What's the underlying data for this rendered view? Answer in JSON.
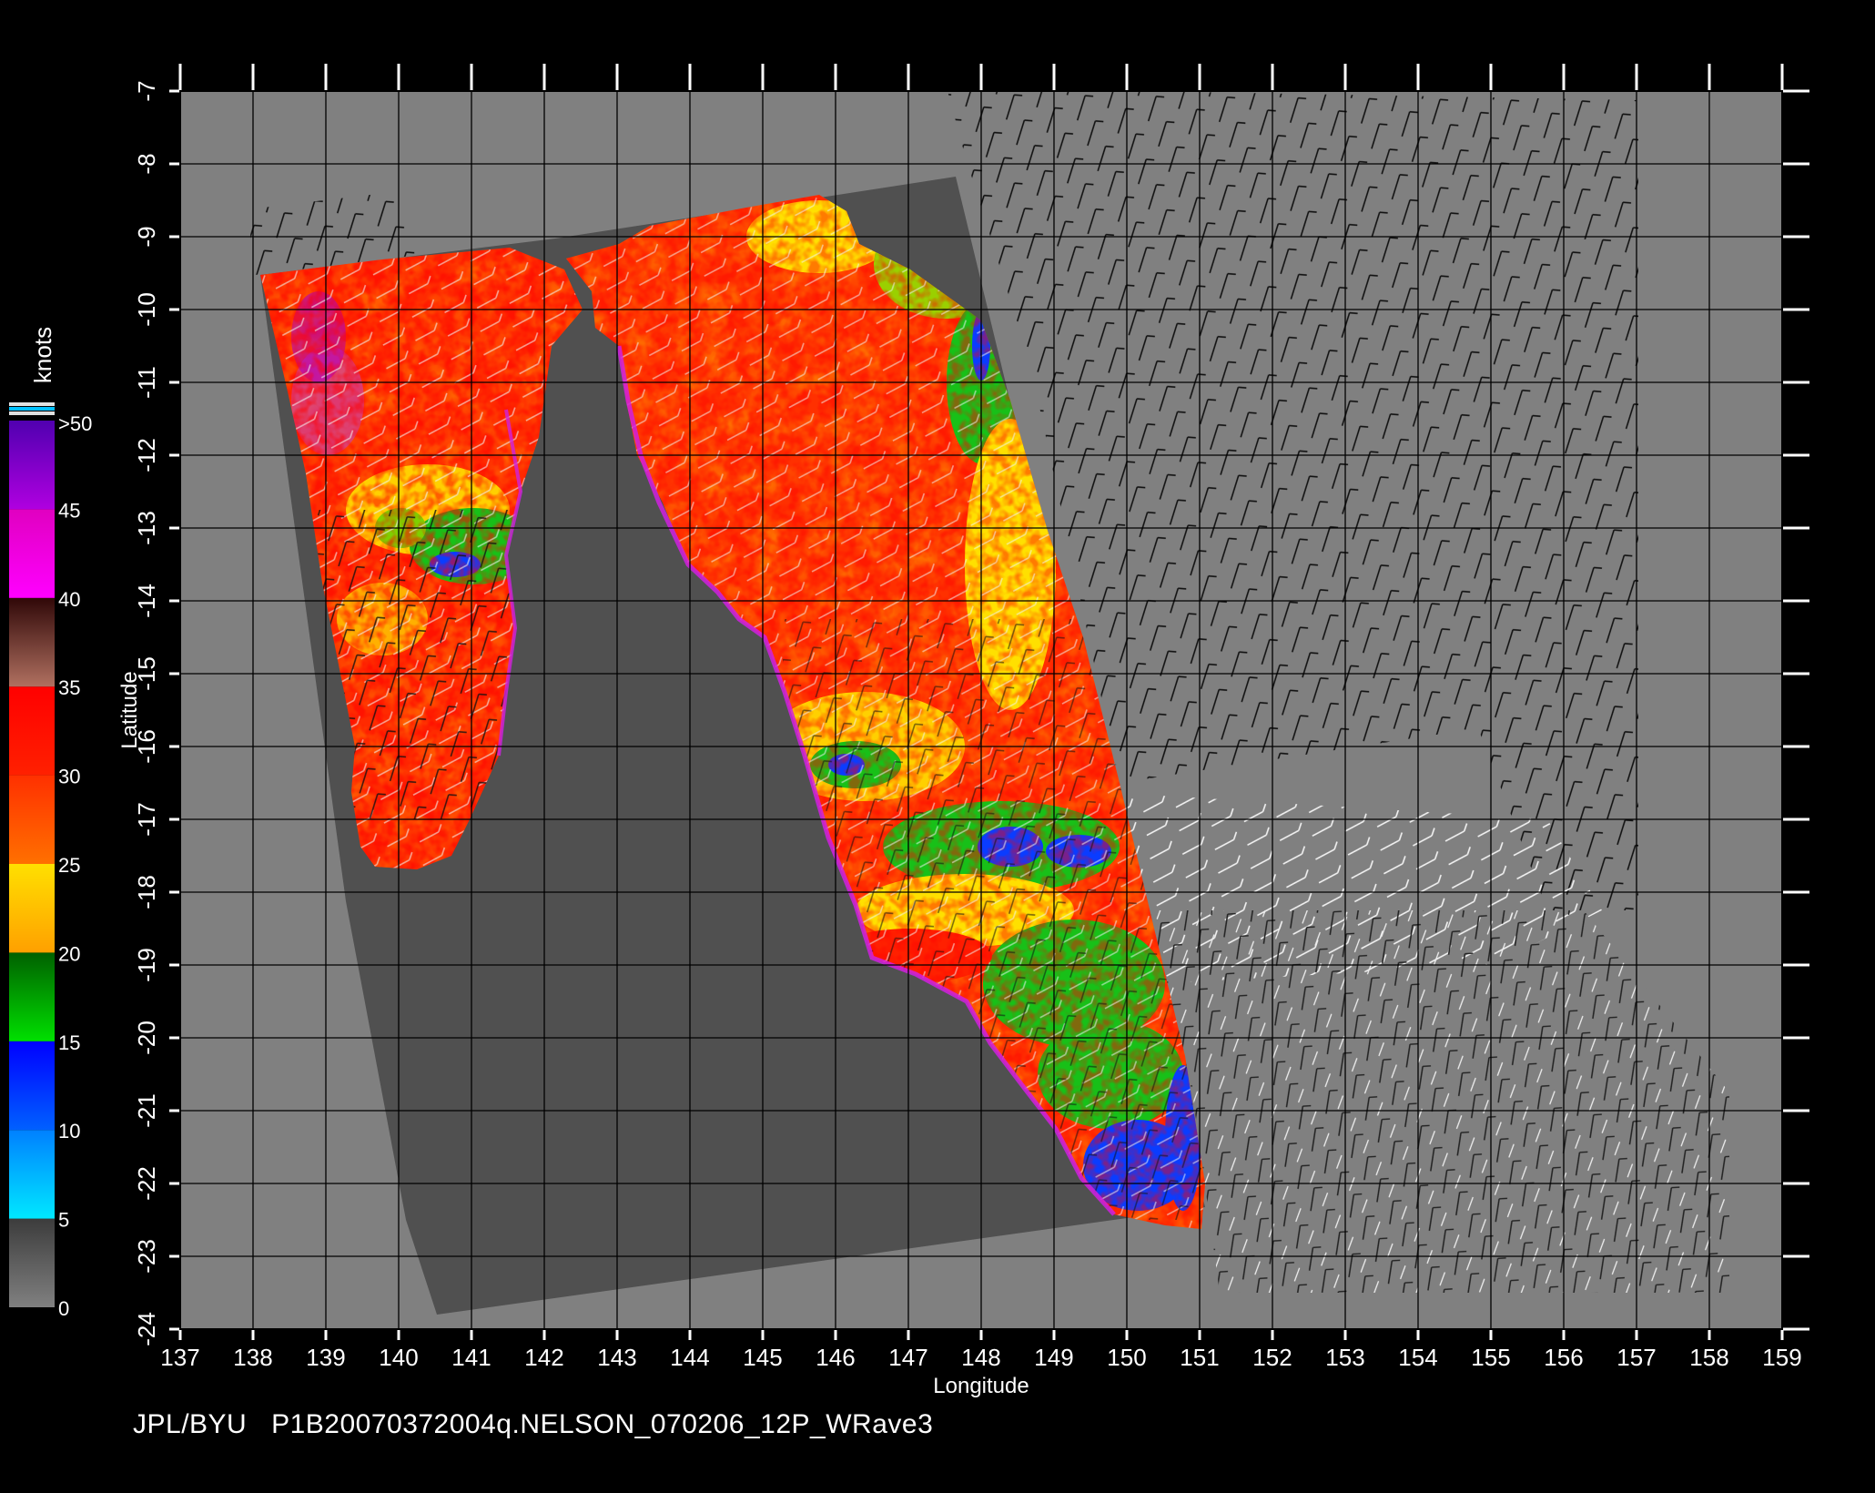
{
  "title_left": "JPL/BYU",
  "title_right": "P1B20070372004q.NELSON_070206_12P_WRave3",
  "axes": {
    "xlabel": "Longitude",
    "ylabel": "Latitude",
    "xlim": [
      137,
      159
    ],
    "ylim": [
      -24,
      -7
    ],
    "xticks": [
      "137",
      "138",
      "139",
      "140",
      "141",
      "142",
      "143",
      "144",
      "145",
      "146",
      "147",
      "148",
      "149",
      "150",
      "151",
      "152",
      "153",
      "154",
      "155",
      "156",
      "157",
      "158",
      "159"
    ],
    "yticks": [
      "-7",
      "-8",
      "-9",
      "-10",
      "-11",
      "-12",
      "-13",
      "-14",
      "-15",
      "-16",
      "-17",
      "-18",
      "-19",
      "-20",
      "-21",
      "-22",
      "-23",
      "-24"
    ]
  },
  "colorbar": {
    "unit": "knots",
    "labels": [
      ">50",
      "45",
      "40",
      "35",
      "30",
      "25",
      "20",
      "15",
      "10",
      "5",
      "0"
    ],
    "bins": [
      {
        "from": 0,
        "to": 5,
        "top": "#3c3c3c",
        "bottom": "#808080"
      },
      {
        "from": 5,
        "to": 10,
        "top": "#0080ff",
        "bottom": "#00e8ff"
      },
      {
        "from": 10,
        "to": 15,
        "top": "#0000ff",
        "bottom": "#0060ff"
      },
      {
        "from": 15,
        "to": 20,
        "top": "#006000",
        "bottom": "#00e000"
      },
      {
        "from": 20,
        "to": 25,
        "top": "#ffe000",
        "bottom": "#ffa000"
      },
      {
        "from": 25,
        "to": 30,
        "top": "#ff3000",
        "bottom": "#ff7000"
      },
      {
        "from": 30,
        "to": 35,
        "top": "#ff0000",
        "bottom": "#ff2000"
      },
      {
        "from": 35,
        "to": 40,
        "top": "#300808",
        "bottom": "#b07060"
      },
      {
        "from": 40,
        "to": 45,
        "top": "#e000c0",
        "bottom": "#ff00ff"
      },
      {
        "from": 45,
        "to": 50,
        "top": "#5000b0",
        "bottom": "#b000e0"
      }
    ],
    "over_colors": [
      "#e0e0e0",
      "#00c0ff",
      "#e0e0e0"
    ]
  },
  "colors": {
    "background": "#000000",
    "plot_bg": "#808080",
    "swath_dark": "#505050",
    "grid": "#000000",
    "text": "#ffffff",
    "barb_dark": "#111111",
    "barb_light": "#ffffff"
  }
}
